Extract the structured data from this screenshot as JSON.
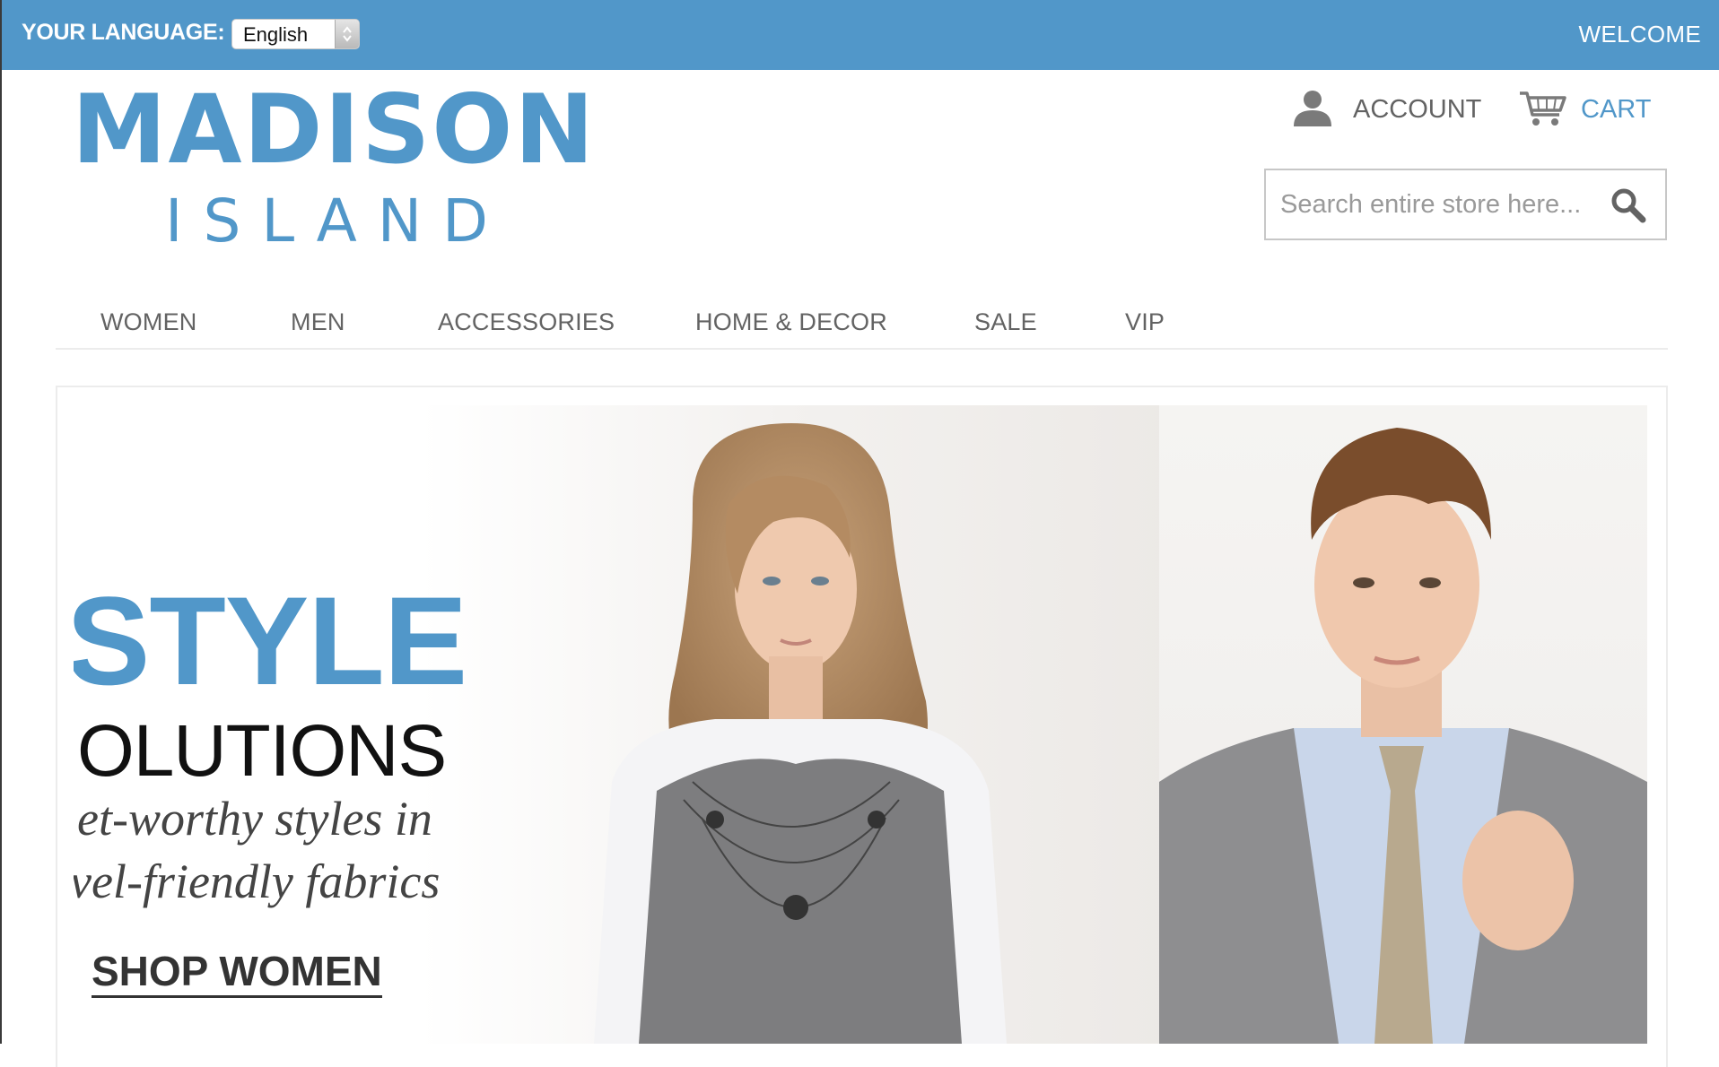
{
  "topbar": {
    "language_label": "YOUR LANGUAGE:",
    "language_selected": "English",
    "welcome": "WELCOME"
  },
  "logo": {
    "line1": "MADISON",
    "line2": "ISLAND"
  },
  "header": {
    "account_label": "ACCOUNT",
    "cart_label": "CART",
    "search_placeholder": "Search entire store here..."
  },
  "nav": {
    "items": [
      {
        "label": "WOMEN"
      },
      {
        "label": "MEN"
      },
      {
        "label": "ACCESSORIES"
      },
      {
        "label": "HOME & DECOR"
      },
      {
        "label": "SALE"
      },
      {
        "label": "VIP"
      }
    ]
  },
  "hero": {
    "headline": "STYLE",
    "subheadline": "OLUTIONS",
    "tagline_line1": "et-worthy styles in",
    "tagline_line2": "vel-friendly fabrics",
    "cta": "SHOP WOMEN"
  },
  "colors": {
    "brand_blue": "#5197c9",
    "text_gray": "#636363"
  },
  "icons": {
    "account": "person-icon",
    "cart": "cart-icon",
    "search": "search-icon",
    "select": "select-arrows-icon"
  }
}
